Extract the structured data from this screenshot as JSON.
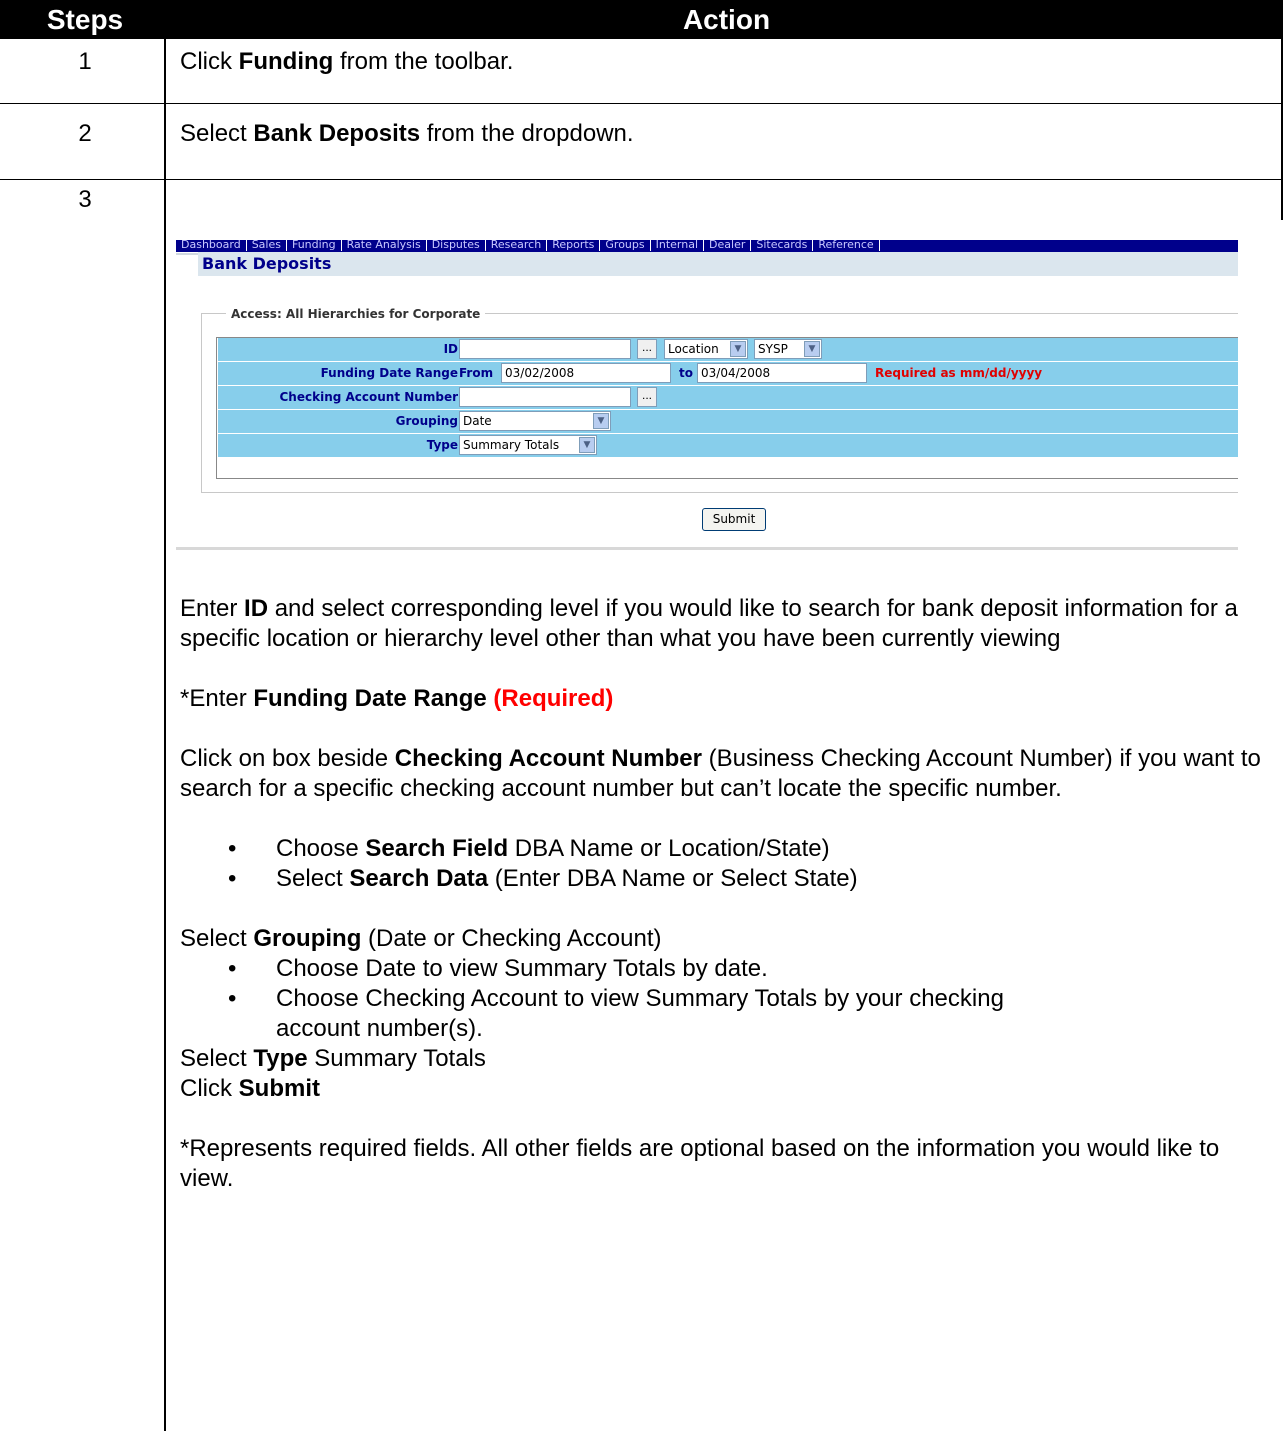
{
  "table": {
    "col_steps": "Steps",
    "col_action": "Action"
  },
  "step1": {
    "num": "1",
    "pre": "Click ",
    "bold": "Funding",
    "post": " from the toolbar."
  },
  "step2": {
    "num": "2",
    "pre": "Select ",
    "bold": "Bank Deposits",
    "post": " from the dropdown."
  },
  "step3": {
    "num": "3"
  },
  "screenshot": {
    "nav_items": [
      "Dashboard",
      "Sales",
      "Funding",
      "Rate Analysis",
      "Disputes",
      "Research",
      "Reports",
      "Groups",
      "Internal",
      "Dealer",
      "Sitecards",
      "Reference"
    ],
    "page_title": "Bank Deposits",
    "access_legend": "Access: All Hierarchies for Corporate",
    "id_label": "ID",
    "id_value": "",
    "id_level": "Location",
    "id_system": "SYSP",
    "funding_label": "Funding Date Range",
    "from_label": "From",
    "from_value": "03/02/2008",
    "to_label": "to",
    "to_value": "03/04/2008",
    "required_note": "Required as mm/dd/yyyy",
    "checking_label": "Checking Account Number",
    "checking_value": "",
    "grouping_label": "Grouping",
    "grouping_value": "Date",
    "type_label": "Type",
    "type_value": "Summary Totals",
    "submit_label": "Submit",
    "dots_label": "..."
  },
  "instructions": {
    "p1_pre": "Enter ",
    "p1_bold": "ID",
    "p1_post": " and select corresponding level if you would like to search for bank deposit information for a specific location or hierarchy level other than what you have been currently viewing",
    "p2_pre": "*Enter ",
    "p2_bold": "Funding Date Range",
    "p2_red": "(Required)",
    "p3_pre": "Click on box beside ",
    "p3_bold": "Checking Account Number",
    "p3_post": " (Business Checking Account Number) if you want to search for a specific checking account number but can’t locate the specific number.",
    "b1_pre": "Choose ",
    "b1_bold": "Search Field",
    "b1_post": " DBA Name or Location/State)",
    "b2_pre": "Select ",
    "b2_bold": "Search Data",
    "b2_post": " (Enter DBA Name or Select State)",
    "p4_pre": "Select ",
    "p4_bold": "Grouping",
    "p4_post": " (Date or Checking Account)",
    "b3": "Choose Date to view Summary Totals by date.",
    "b4a": "Choose Checking Account to view Summary Totals by your checking",
    "b4b": "account number(s).",
    "p5_pre": "Select ",
    "p5_bold": "Type",
    "p5_post": " Summary Totals",
    "p6_pre": "Click ",
    "p6_bold": "Submit",
    "p7": "*Represents required fields. All other fields are optional based on the information you would like to view.",
    "bullet": "•"
  }
}
